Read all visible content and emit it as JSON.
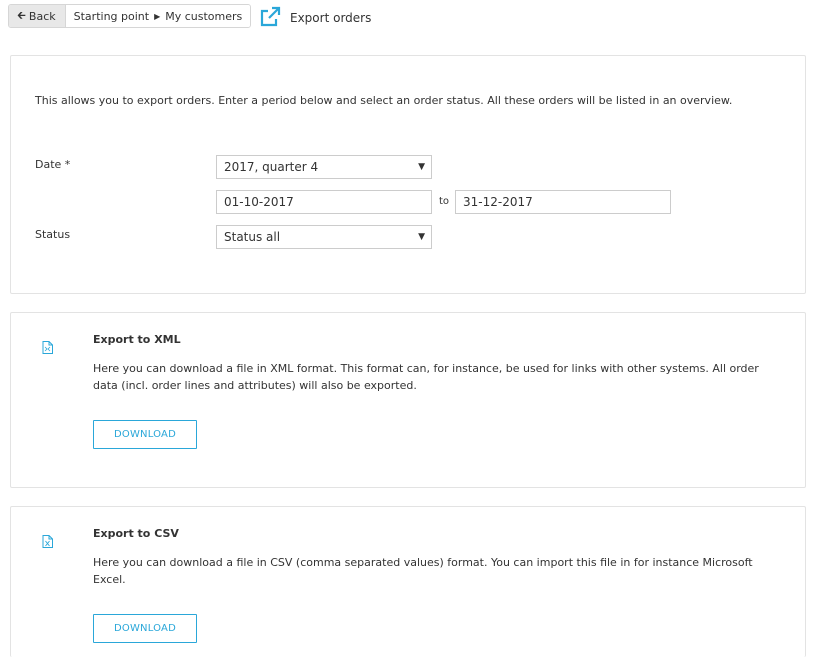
{
  "nav": {
    "back_label": "Back",
    "breadcrumb": [
      "Starting point",
      "My customers"
    ]
  },
  "page": {
    "title": "Export orders"
  },
  "filters": {
    "intro": "This allows you to export orders. Enter a period below and select an order status. All these orders will be listed in an overview.",
    "date_label": "Date *",
    "period_value": "2017, quarter 4",
    "date_from": "01-10-2017",
    "to_label": "to",
    "date_to": "31-12-2017",
    "status_label": "Status",
    "status_value": "Status all"
  },
  "exports": [
    {
      "title": "Export to XML",
      "description": "Here you can download a file in XML format. This format can, for instance, be used for links with other systems. All order data (incl. order lines and attributes) will also be exported.",
      "button": "DOWNLOAD",
      "icon": "xml-file-icon"
    },
    {
      "title": "Export to CSV",
      "description": "Here you can download a file in CSV (comma separated values) format. You can import this file in for instance Microsoft Excel.",
      "button": "DOWNLOAD",
      "icon": "excel-file-icon"
    }
  ],
  "colors": {
    "accent": "#2aa7d9",
    "border": "#e3e3e3"
  }
}
